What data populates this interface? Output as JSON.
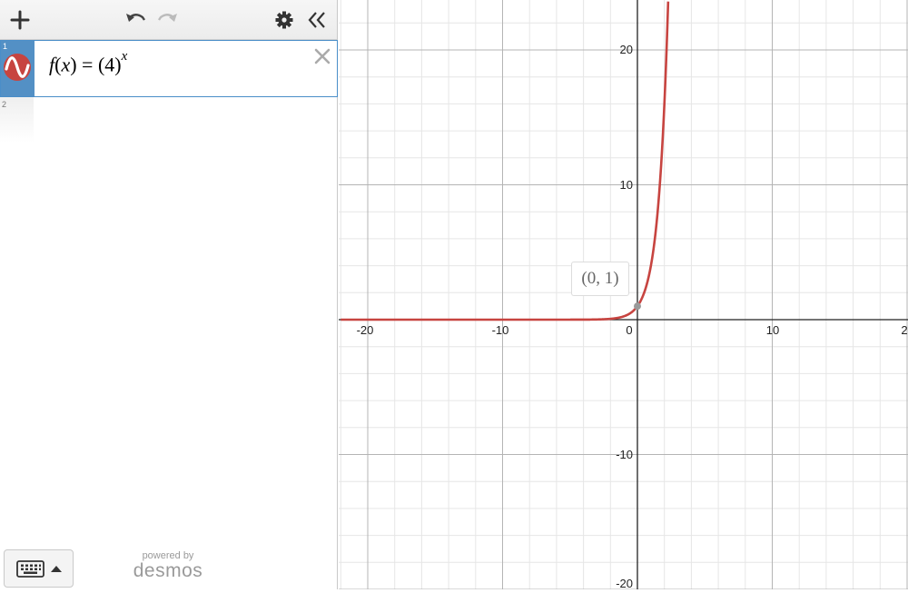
{
  "toolbar": {
    "icons": [
      "plus-icon",
      "undo-icon",
      "redo-icon",
      "gear-icon",
      "collapse-icon"
    ]
  },
  "expressions": [
    {
      "number": "1",
      "fn": "f",
      "var": "x",
      "equals": "=",
      "base": "(4)",
      "exponent": "x",
      "color": "#c74440"
    },
    {
      "number": "2"
    }
  ],
  "branding": {
    "small": "powered by",
    "brand": "desmos"
  },
  "graph": {
    "x_ticks": [
      "-20",
      "-10",
      "0",
      "10",
      "2"
    ],
    "y_ticks": [
      "20",
      "10",
      "-10",
      "-20"
    ],
    "point_label": "(0, 1)",
    "curve_color": "#c74440"
  },
  "chart_data": {
    "type": "line",
    "series": [
      {
        "name": "f(x) = (4)^x",
        "x": [
          -22,
          -10,
          -5,
          -2,
          -1,
          0,
          0.5,
          1,
          1.5,
          2,
          2.28
        ],
        "y": [
          0,
          0,
          0.001,
          0.0625,
          0.25,
          1,
          2,
          4,
          8,
          16,
          23.5
        ]
      }
    ],
    "xlim": [
      -22,
      20
    ],
    "ylim": [
      -20,
      23.5
    ],
    "points": [
      {
        "x": 0,
        "y": 1,
        "label": "(0, 1)"
      }
    ],
    "grid": true
  }
}
